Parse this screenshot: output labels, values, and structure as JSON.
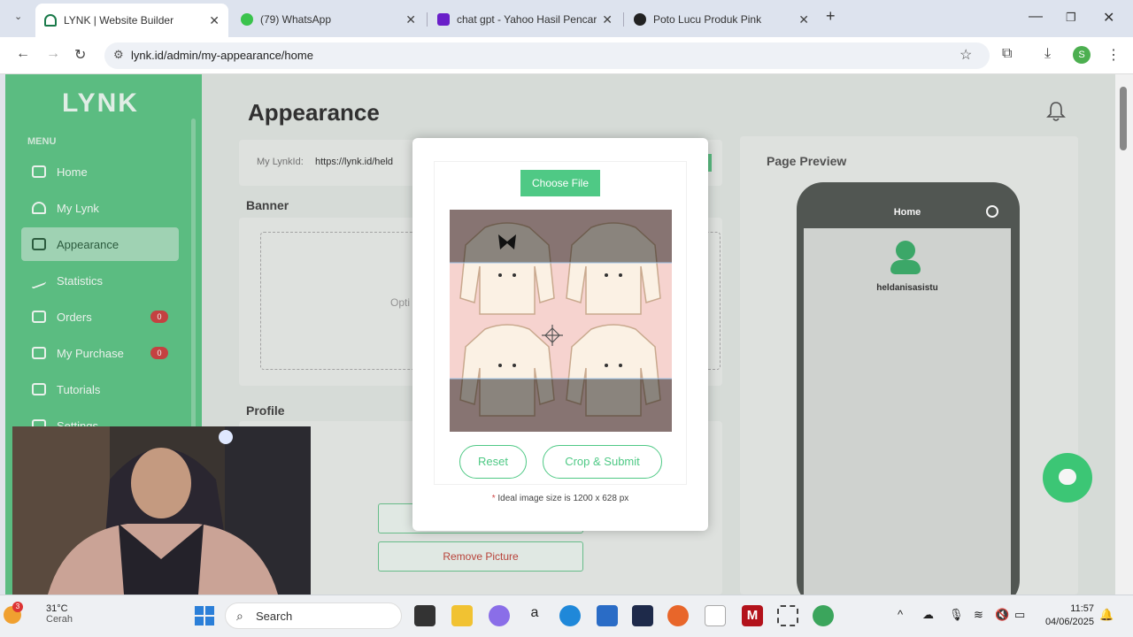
{
  "browser": {
    "tabs": [
      {
        "label": "LYNK | Website Builder",
        "active": true
      },
      {
        "label": "(79) WhatsApp",
        "active": false
      },
      {
        "label": "chat gpt - Yahoo Hasil Pencaria",
        "active": false
      },
      {
        "label": "Poto Lucu Produk Pink",
        "active": false
      }
    ],
    "url": "lynk.id/admin/my-appearance/home"
  },
  "sidebar": {
    "logo": "LYNK",
    "menu_label": "MENU",
    "items": [
      {
        "label": "Home",
        "icon": "home-icon"
      },
      {
        "label": "My Lynk",
        "icon": "link-icon"
      },
      {
        "label": "Appearance",
        "icon": "monitor-icon",
        "active": true
      },
      {
        "label": "Statistics",
        "icon": "chart-icon"
      },
      {
        "label": "Orders",
        "icon": "orders-icon",
        "badge": "0"
      },
      {
        "label": "My Purchase",
        "icon": "purchase-icon",
        "badge": "0"
      },
      {
        "label": "Tutorials",
        "icon": "play-icon"
      },
      {
        "label": "Settings",
        "icon": "gear-icon"
      }
    ]
  },
  "main": {
    "title": "Appearance",
    "lynk_label": "My LynkId:",
    "lynk_value": "https://lynk.id/held",
    "banner_label": "Banner",
    "banner_placeholder": "Opti",
    "profile_label": "Profile",
    "remove_picture": "Remove Picture"
  },
  "preview": {
    "title": "Page Preview",
    "phone_header": "Home",
    "username": "heldanisasistu"
  },
  "modal": {
    "choose_file": "Choose File",
    "reset": "Reset",
    "crop_submit": "Crop & Submit",
    "hint_star": "*",
    "hint": "Ideal image size is 1200 x 628 px"
  },
  "taskbar": {
    "temp": "31°C",
    "weather": "Cerah",
    "weather_badge": "3",
    "search": "Search",
    "time": "11:57",
    "date": "04/06/2025"
  },
  "colors": {
    "brand_green": "#5fc487",
    "accent_green": "#4fc985",
    "crop_pink": "#f6d3cf"
  }
}
